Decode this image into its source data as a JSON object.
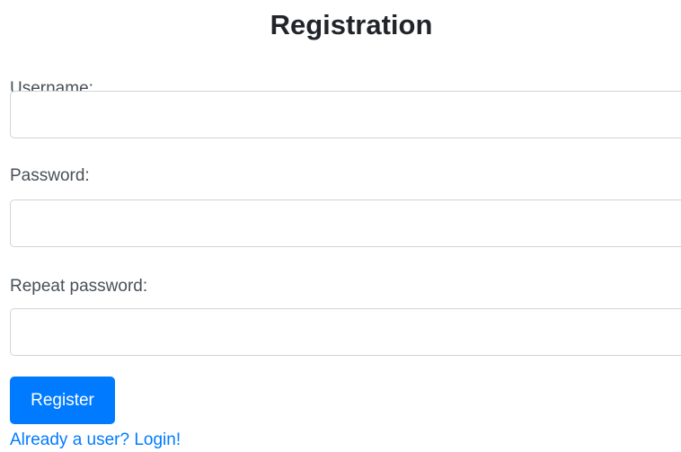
{
  "form": {
    "title": "Registration",
    "fields": [
      {
        "label": "Username:",
        "value": "",
        "placeholder": ""
      },
      {
        "label": "Password:",
        "value": "",
        "placeholder": ""
      },
      {
        "label": "Repeat password:",
        "value": "",
        "placeholder": ""
      }
    ],
    "submit_label": "Register",
    "login_link": "Already a user? Login!"
  },
  "colors": {
    "primary": "#007bff",
    "label_text": "#495057",
    "input_border": "#ced4da"
  }
}
